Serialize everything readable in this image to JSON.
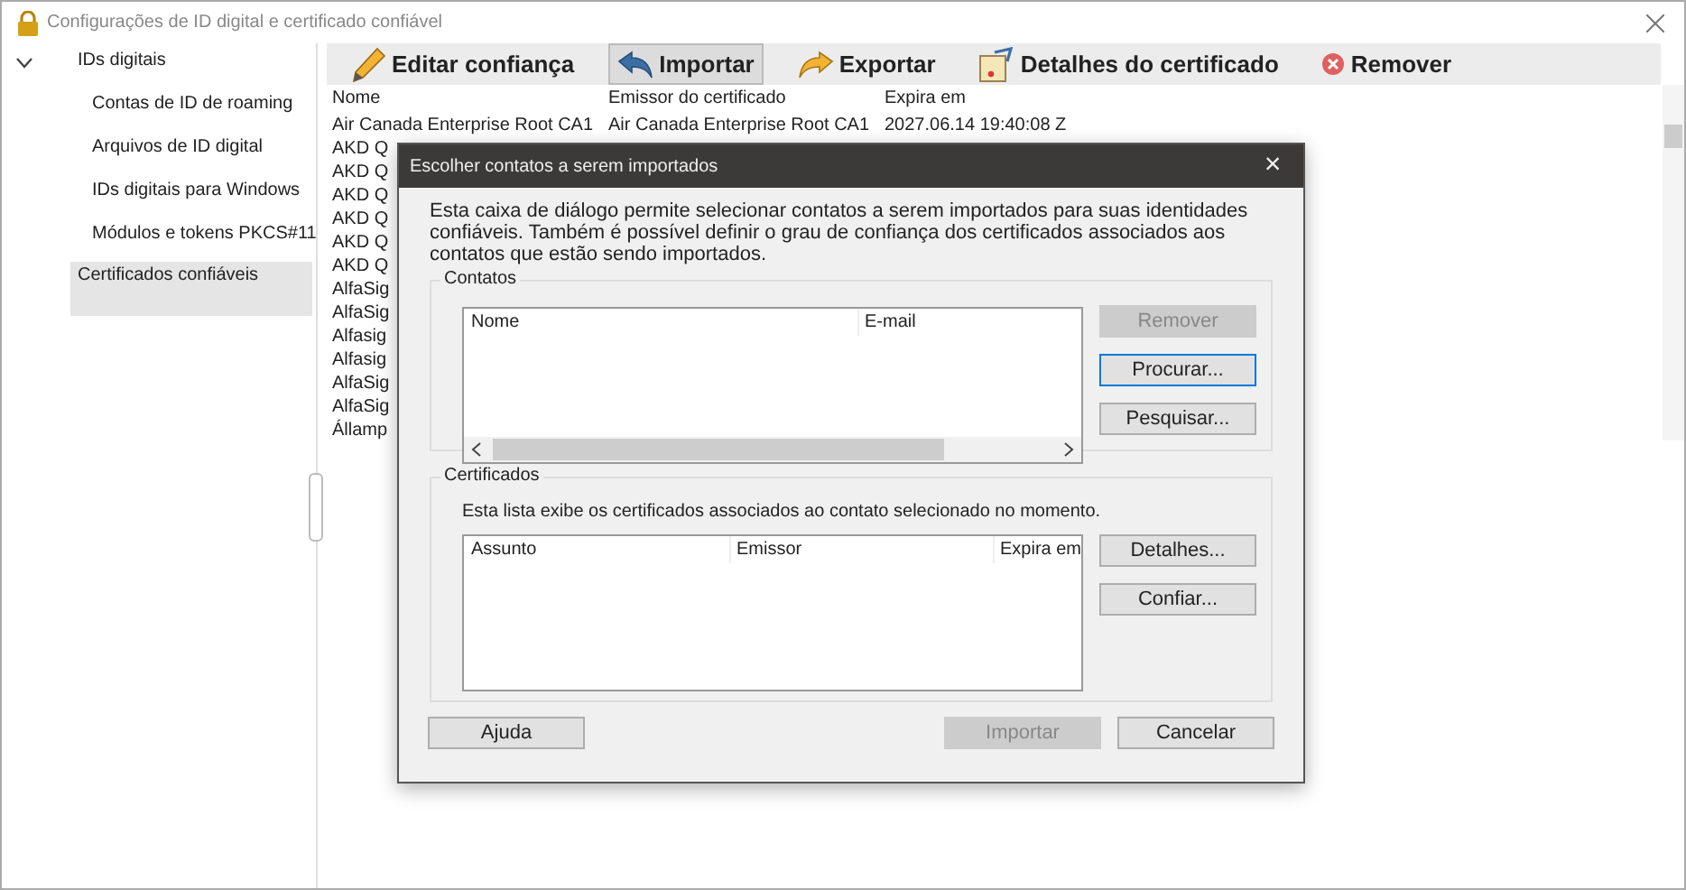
{
  "window": {
    "title": "Configurações de ID digital e certificado confiável"
  },
  "sidebar": {
    "items": [
      {
        "label": "IDs digitais",
        "expanded": true,
        "selected": false,
        "children": [
          {
            "label": "Contas de ID de roaming",
            "selected": false
          },
          {
            "label": "Arquivos de ID digital",
            "selected": false
          },
          {
            "label": "IDs digitais para Windows",
            "selected": false
          },
          {
            "label": "Módulos e tokens PKCS#11",
            "selected": false
          }
        ]
      },
      {
        "label": "Certificados confiáveis",
        "selected": true
      }
    ]
  },
  "toolbar": [
    {
      "kind": "pencil",
      "label": "Editar confiança",
      "selected": false
    },
    {
      "kind": "import",
      "label": "Importar",
      "selected": true
    },
    {
      "kind": "export",
      "label": "Exportar",
      "selected": false
    },
    {
      "kind": "certificate",
      "label": "Detalhes do certificado",
      "selected": false
    },
    {
      "kind": "remove",
      "label": "Remover",
      "selected": false
    }
  ],
  "table": {
    "columns": [
      "Nome",
      "Emissor do certificado",
      "Expira em"
    ],
    "rows": [
      [
        "Air Canada Enterprise Root CA1",
        "Air Canada Enterprise Root CA1",
        "2027.06.14 19:40:08 Z"
      ],
      [
        "AKD Q"
      ],
      [
        "AKD Q"
      ],
      [
        "AKD Q"
      ],
      [
        "AKD Q"
      ],
      [
        "AKD Q"
      ],
      [
        "AKD Q"
      ],
      [
        "AlfaSig"
      ],
      [
        "AlfaSig"
      ],
      [
        "Alfasig"
      ],
      [
        "Alfasig"
      ],
      [
        "AlfaSig"
      ],
      [
        "AlfaSig"
      ],
      [
        "Államp"
      ]
    ]
  },
  "dialog": {
    "title": "Escolher contatos a serem importados",
    "close": "×",
    "intro": "Esta caixa de diálogo permite selecionar contatos a serem importados para suas identidades confiáveis. Também é possível definir o grau de confiança dos certificados associados aos contatos que estão sendo importados.",
    "contacts": {
      "legend": "Contatos",
      "columns": [
        "Nome",
        "E-mail"
      ],
      "buttons": [
        {
          "label": "Remover",
          "disabled": true,
          "focused": false
        },
        {
          "label": "Procurar...",
          "disabled": false,
          "focused": true
        },
        {
          "label": "Pesquisar...",
          "disabled": false,
          "focused": false
        }
      ]
    },
    "certificates": {
      "legend": "Certificados",
      "description": "Esta lista exibe os certificados associados ao contato selecionado no momento.",
      "columns": [
        "Assunto",
        "Emissor",
        "Expira em"
      ],
      "buttons": [
        {
          "label": "Detalhes...",
          "disabled": false,
          "focused": false
        },
        {
          "label": "Confiar...",
          "disabled": false,
          "focused": false
        }
      ]
    },
    "footer": [
      {
        "label": "Ajuda",
        "disabled": false
      },
      {
        "label": "Importar",
        "disabled": true
      },
      {
        "label": "Cancelar",
        "disabled": false
      }
    ]
  }
}
